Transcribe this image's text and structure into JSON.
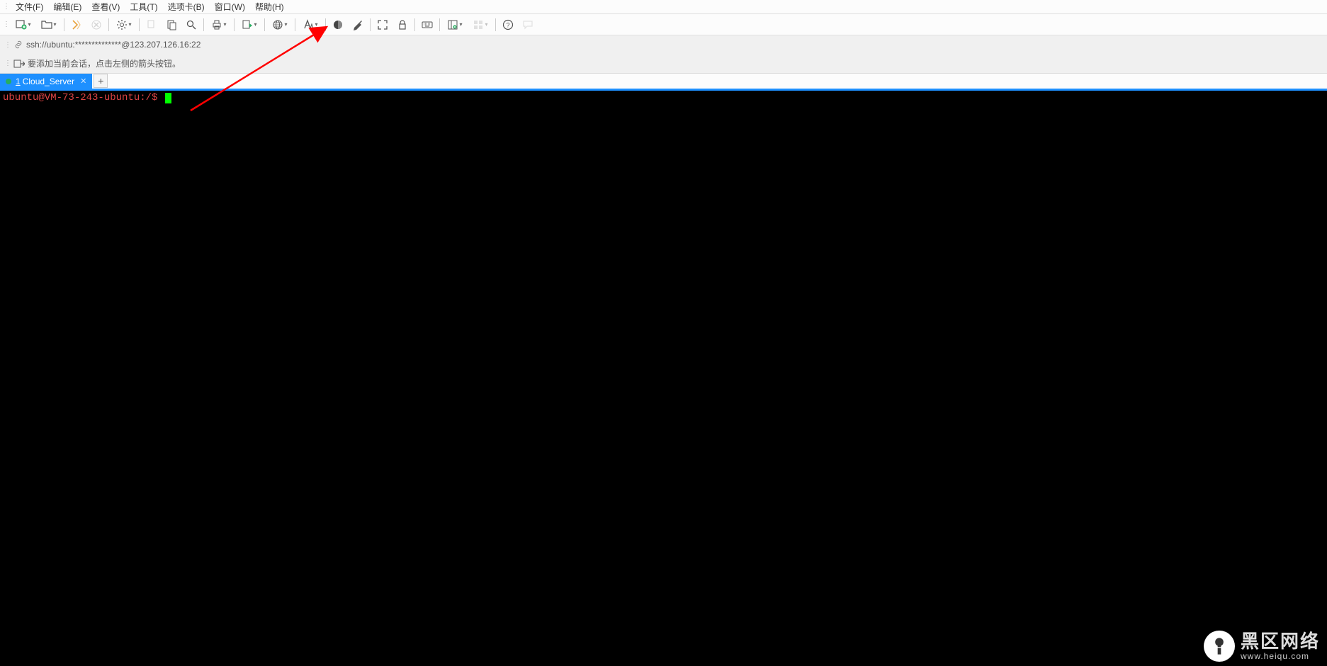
{
  "menu": {
    "file": "文件(F)",
    "edit": "编辑(E)",
    "view": "查看(V)",
    "tools": "工具(T)",
    "tabs": "选项卡(B)",
    "window": "窗口(W)",
    "help": "帮助(H)"
  },
  "toolbar_icons": {
    "new": "new-session-icon",
    "open": "open-folder-icon",
    "reconnect": "reconnect-icon",
    "disconnect": "disconnect-icon",
    "properties": "properties-icon",
    "copy": "copy-icon",
    "paste": "paste-icon",
    "find": "find-icon",
    "print": "print-icon",
    "transfer": "transfer-icon",
    "globe": "globe-icon",
    "font": "font-icon",
    "color": "color-scheme-icon",
    "highlight": "highlight-icon",
    "fullscreen": "fullscreen-icon",
    "lock": "lock-icon",
    "keyboard": "keyboard-icon",
    "sidebar": "sidebar-icon",
    "list": "list-icon",
    "help": "help-icon",
    "chat": "chat-icon"
  },
  "address": {
    "url": "ssh://ubuntu:**************@123.207.126.16:22"
  },
  "hint": {
    "text": "要添加当前会话，点击左侧的箭头按钮。"
  },
  "tabs": [
    {
      "num": "1",
      "label": "Cloud_Server"
    }
  ],
  "terminal": {
    "prompt": "ubuntu@VM-73-243-ubuntu:/$ "
  },
  "watermark": {
    "cn": "黑区网络",
    "en": "www.heiqu.com"
  }
}
